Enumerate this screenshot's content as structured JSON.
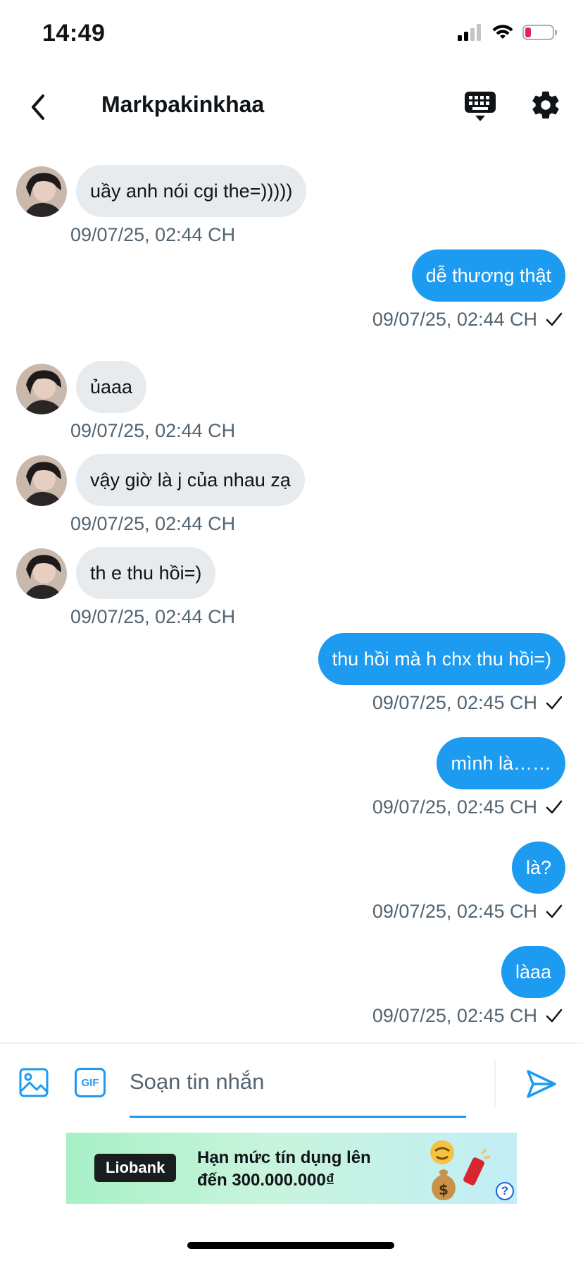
{
  "status_bar": {
    "time": "14:49",
    "icons": [
      "signal-icon",
      "wifi-icon",
      "battery-low-icon"
    ],
    "battery_color": "#e0245e"
  },
  "header": {
    "back_icon": "chevron-left-icon",
    "title": "Markpakinkhaa",
    "keyboard_icon": "keyboard-icon",
    "settings_icon": "gear-icon"
  },
  "colors": {
    "accent": "#1d9bf0",
    "incoming_bubble": "#e8ebee",
    "timestamp": "#536471"
  },
  "messages": [
    {
      "direction": "in",
      "text": "uầy anh nói cgi the=)))))",
      "time": "09/07/25, 02:44 CH"
    },
    {
      "direction": "out",
      "text": "dễ thương thật",
      "time": "09/07/25, 02:44 CH",
      "status_icon": "checkmark-icon"
    },
    {
      "direction": "in",
      "text": "ủaaa",
      "time": "09/07/25, 02:44 CH"
    },
    {
      "direction": "in",
      "text": "vậy giờ là j của nhau zạ",
      "time": "09/07/25, 02:44 CH"
    },
    {
      "direction": "in",
      "text": "th e thu hồi=)",
      "time": "09/07/25, 02:44 CH"
    },
    {
      "direction": "out",
      "text": "thu hồi mà h chx thu hồi=)",
      "time": "09/07/25, 02:45 CH",
      "status_icon": "checkmark-icon"
    },
    {
      "direction": "out",
      "text": "mình là……",
      "time": "09/07/25, 02:45 CH",
      "status_icon": "checkmark-icon"
    },
    {
      "direction": "out",
      "text": "là?",
      "time": "09/07/25, 02:45 CH",
      "status_icon": "checkmark-icon"
    },
    {
      "direction": "out",
      "text": "làaa",
      "time": "09/07/25, 02:45 CH",
      "status_icon": "checkmark-icon"
    }
  ],
  "composer": {
    "image_icon": "image-icon",
    "gif_label": "GIF",
    "placeholder": "Soạn tin nhắn",
    "value": "",
    "send_icon": "send-icon"
  },
  "ad": {
    "brand": "Liobank",
    "line1": "Hạn mức tín dụng lên",
    "line2": "đến 300.000.000₫",
    "help": "?"
  }
}
